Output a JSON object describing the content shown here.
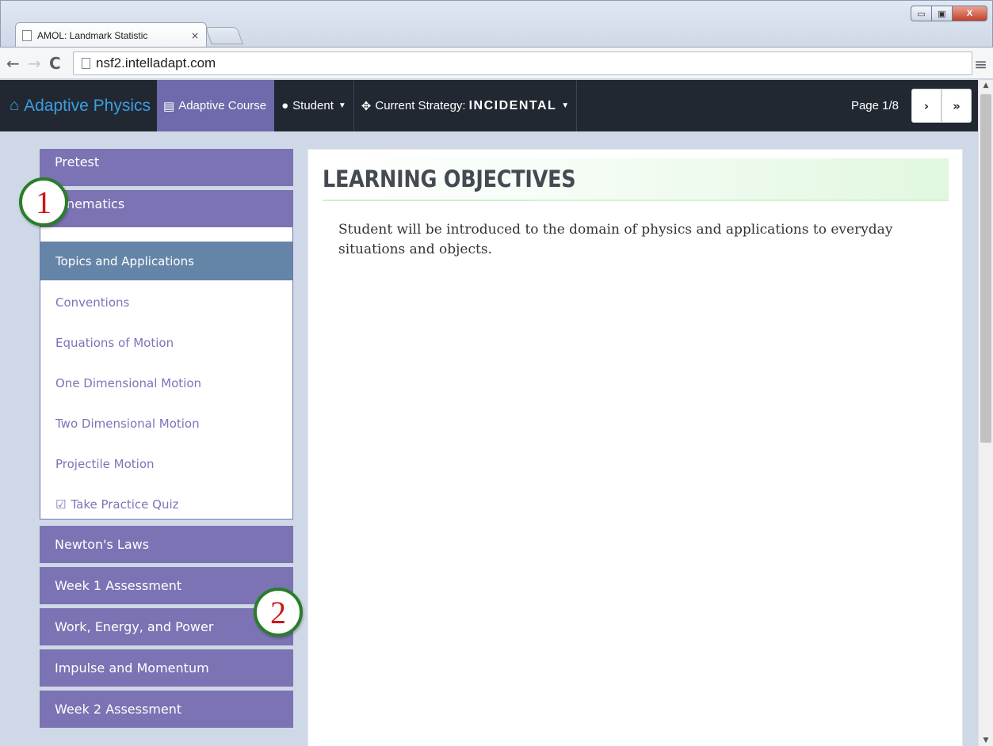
{
  "browser": {
    "tab_title": "AMOL: Landmark Statistic",
    "tab_close": "×",
    "url": "nsf2.intelladapt.com",
    "window_buttons": {
      "minimize": "▭",
      "maximize": "▣",
      "close": "X"
    }
  },
  "navbar": {
    "brand": "Adaptive Physics",
    "course": "Adaptive Course",
    "student": "Student",
    "strategy_label": "Current Strategy:",
    "strategy_value": "INCIDENTAL",
    "page_indicator": "Page 1/8",
    "next_symbol": "›",
    "last_symbol": "»"
  },
  "sidebar": {
    "pretest": "Pretest",
    "kinematics": "Kinematics",
    "kinematics_items": [
      "Topics and Applications",
      "Conventions",
      "Equations of Motion",
      "One Dimensional Motion",
      "Two Dimensional Motion",
      "Projectile Motion",
      "Take Practice Quiz"
    ],
    "sections_after": [
      "Newton's Laws",
      "Week 1 Assessment",
      "Work, Energy, and Power",
      "Impulse and Momentum",
      "Week 2 Assessment"
    ]
  },
  "main": {
    "heading": "LEARNING OBJECTIVES",
    "text": "Student will be introduced to the domain of physics and applications to everyday situations and objects."
  },
  "callouts": [
    "1",
    "2"
  ],
  "colors": {
    "navbar_bg": "#222831",
    "brand_blue": "#3c9de0",
    "section_purple": "#7b73b3",
    "active_item": "#6585a8",
    "callout_border": "#2a7d2a",
    "callout_number": "#d01616"
  },
  "icons": [
    "page-icon",
    "back-arrow-icon",
    "forward-arrow-icon",
    "reload-icon",
    "menu-icon",
    "home-icon",
    "briefcase-icon",
    "user-icon",
    "move-icon",
    "caret-down-icon",
    "checkbox-icon",
    "chevron-right-icon",
    "fast-forward-icon"
  ]
}
